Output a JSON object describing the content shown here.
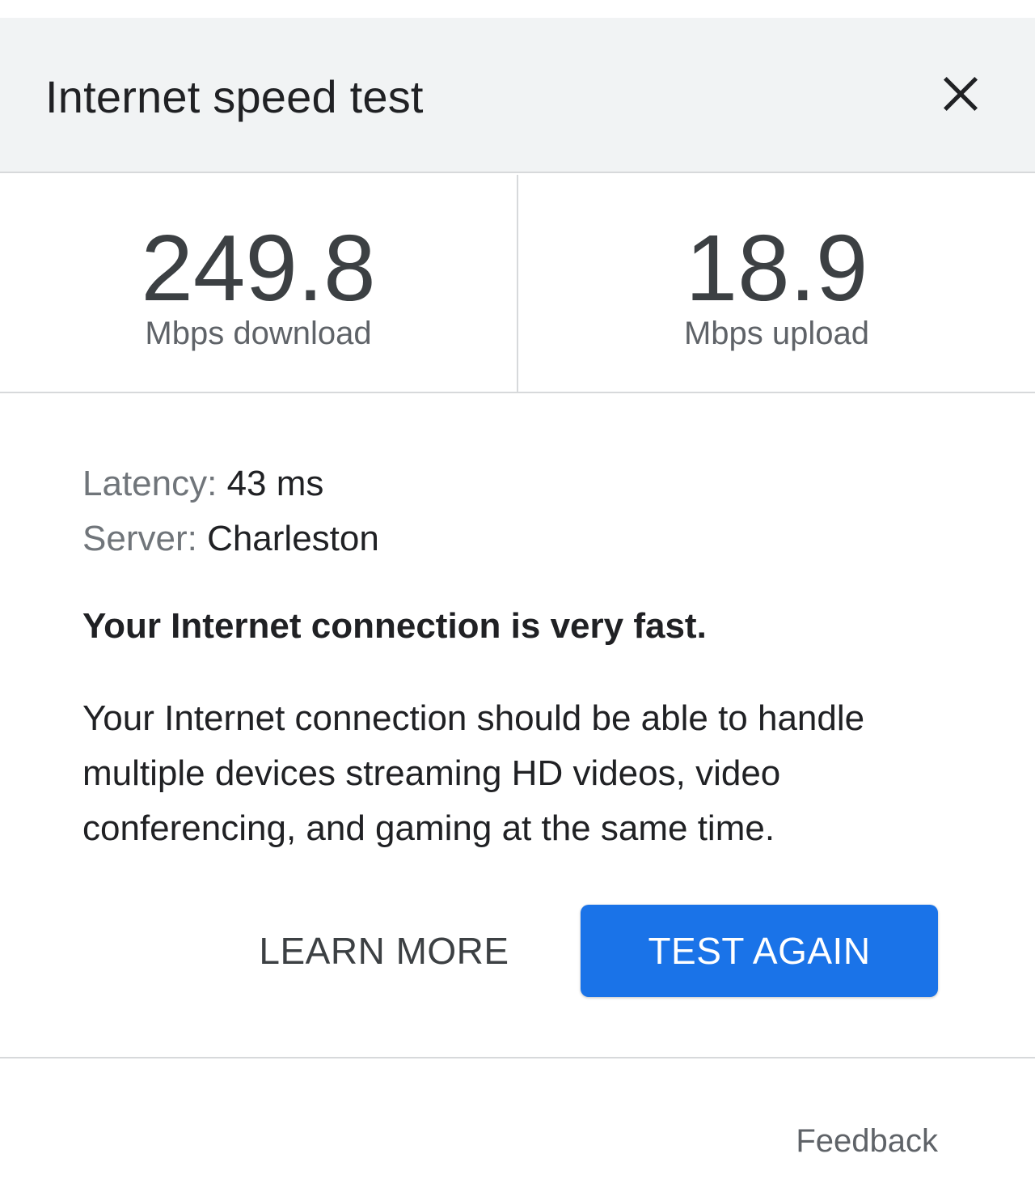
{
  "header": {
    "title": "Internet speed test",
    "close_icon": "close-icon"
  },
  "stats": {
    "download": {
      "value": "249.8",
      "unit": "Mbps download"
    },
    "upload": {
      "value": "18.9",
      "unit": "Mbps upload"
    }
  },
  "details": {
    "latency_label": "Latency:",
    "latency_value": "43 ms",
    "server_label": "Server:",
    "server_value": "Charleston"
  },
  "result": {
    "headline": "Your Internet connection is very fast.",
    "description": "Your Internet connection should be able to handle multiple devices streaming HD videos, video conferencing, and gaming at the same time."
  },
  "actions": {
    "learn_more": "LEARN MORE",
    "test_again": "TEST AGAIN"
  },
  "footer": {
    "feedback": "Feedback"
  },
  "colors": {
    "accent": "#1a73e8",
    "header_bg": "#f1f3f4",
    "divider": "#d7d9db"
  }
}
